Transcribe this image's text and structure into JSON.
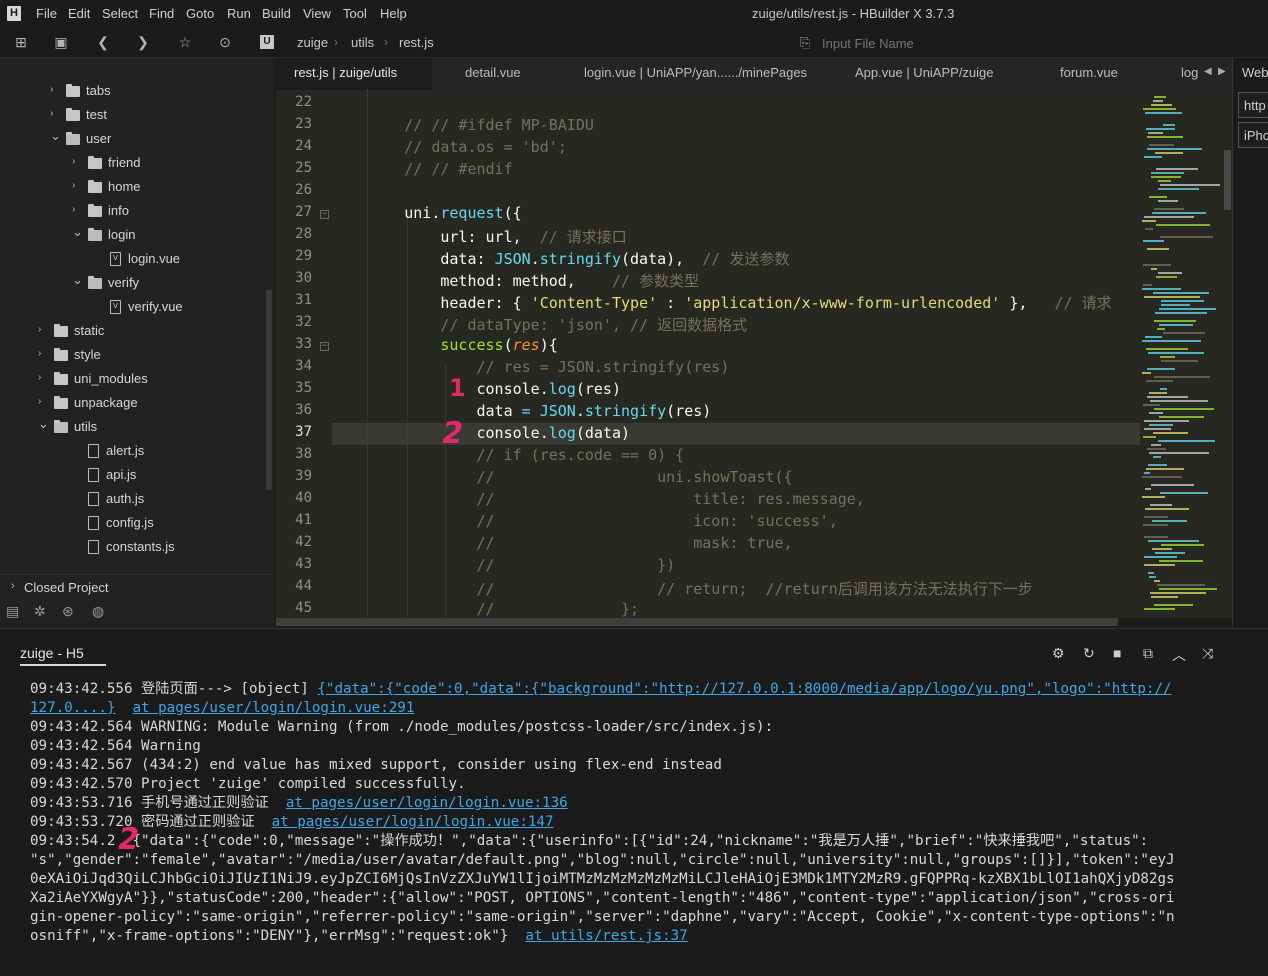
{
  "app": {
    "title": "zuige/utils/rest.js - HBuilder X 3.7.3",
    "menu": [
      "File",
      "Edit",
      "Select",
      "Find",
      "Goto",
      "Run",
      "Build",
      "View",
      "Tool",
      "Help"
    ]
  },
  "toolbar": {
    "breadcrumb": [
      "zuige",
      "utils",
      "rest.js"
    ],
    "file_search_placeholder": "Input File Name"
  },
  "sidebar": {
    "tree": [
      {
        "label": "tabs",
        "type": "folder",
        "expanded": false
      },
      {
        "label": "test",
        "type": "folder",
        "expanded": false
      },
      {
        "label": "user",
        "type": "folder",
        "expanded": true
      },
      {
        "label": "friend",
        "type": "folder",
        "expanded": false
      },
      {
        "label": "home",
        "type": "folder",
        "expanded": false
      },
      {
        "label": "info",
        "type": "folder",
        "expanded": false
      },
      {
        "label": "login",
        "type": "folder",
        "expanded": true
      },
      {
        "label": "login.vue",
        "type": "vue"
      },
      {
        "label": "verify",
        "type": "folder",
        "expanded": true
      },
      {
        "label": "verify.vue",
        "type": "vue"
      },
      {
        "label": "static",
        "type": "folder",
        "expanded": false
      },
      {
        "label": "style",
        "type": "folder",
        "expanded": false
      },
      {
        "label": "uni_modules",
        "type": "folder",
        "expanded": false
      },
      {
        "label": "unpackage",
        "type": "folder",
        "expanded": false
      },
      {
        "label": "utils",
        "type": "folder",
        "expanded": true
      },
      {
        "label": "alert.js",
        "type": "js"
      },
      {
        "label": "api.js",
        "type": "js"
      },
      {
        "label": "auth.js",
        "type": "js"
      },
      {
        "label": "config.js",
        "type": "js"
      },
      {
        "label": "constants.js",
        "type": "js"
      }
    ],
    "closed_project_label": "Closed Project"
  },
  "tabs": [
    {
      "label": "rest.js | zuige/utils",
      "active": true
    },
    {
      "label": "detail.vue",
      "active": false
    },
    {
      "label": "login.vue | UniAPP/yan....../minePages",
      "active": false
    },
    {
      "label": "App.vue | UniAPP/zuige",
      "active": false
    },
    {
      "label": "forum.vue",
      "active": false
    },
    {
      "label": "log",
      "active": false
    }
  ],
  "editor": {
    "line_numbers": [
      "22",
      "23",
      "24",
      "25",
      "26",
      "27",
      "28",
      "29",
      "30",
      "31",
      "32",
      "33",
      "34",
      "35",
      "36",
      "37",
      "38",
      "39",
      "40",
      "41",
      "42",
      "43",
      "44",
      "45"
    ],
    "highlighted_line": "37"
  },
  "right_panel": {
    "label": "Web",
    "url_field": "http",
    "device_field": "iPho"
  },
  "console": {
    "tab_label": "zuige - H5",
    "lines": [
      {
        "t": "09:43:42.556 登陆页面---> [object] ",
        "link": "{\"data\":{\"code\":0,\"data\":{\"background\":\"http://127.0.0.1:8000/media/app/logo/yu.png\",\"logo\":\"http://"
      },
      {
        "t": "",
        "link": "127.0....}",
        "link2": "at pages/user/login/login.vue:291"
      },
      {
        "t": "09:43:42.564 WARNING: Module Warning (from ./node_modules/postcss-loader/src/index.js):"
      },
      {
        "t": "09:43:42.564 Warning"
      },
      {
        "t": "09:43:42.567 (434:2) end value has mixed support, consider using flex-end instead"
      },
      {
        "t": "09:43:42.570 Project 'zuige' compiled successfully."
      },
      {
        "t": "09:43:53.716 手机号通过正则验证  ",
        "link": "at pages/user/login/login.vue:136"
      },
      {
        "t": "09:43:53.720 密码通过正则验证  ",
        "link": "at pages/user/login/login.vue:147"
      },
      {
        "t": "09:43:54.2  {\"data\":{\"code\":0,\"message\":\"操作成功！\",\"data\":{\"userinfo\":[{\"id\":24,\"nickname\":\"我是万人捶\",\"brief\":\"快来捶我吧\",\"status\":"
      },
      {
        "t": "\"s\",\"gender\":\"female\",\"avatar\":\"/media/user/avatar/default.png\",\"blog\":null,\"circle\":null,\"university\":null,\"groups\":[]}],\"token\":\"eyJ"
      },
      {
        "t": "0eXAiOiJqd3QiLCJhbGciOiJIUzI1NiJ9.eyJpZCI6MjQsInVzZXJuYW1lIjoiMTMzMzMzMzMzMzMiLCJleHAiOjE3MDk1MTY2MzR9.gFQPPRq-kzXBX1bLlOI1ahQXjyD82gs"
      },
      {
        "t": "Xa2iAeYXWgyA\"}},\"statusCode\":200,\"header\":{\"allow\":\"POST, OPTIONS\",\"content-length\":\"486\",\"content-type\":\"application/json\",\"cross-ori"
      },
      {
        "t": "gin-opener-policy\":\"same-origin\",\"referrer-policy\":\"same-origin\",\"server\":\"daphne\",\"vary\":\"Accept, Cookie\",\"x-content-type-options\":\"n"
      },
      {
        "t": "osniff\",\"x-frame-options\":\"DENY\"},\"errMsg\":\"request:ok\"}  ",
        "link": "at utils/rest.js:37"
      }
    ]
  },
  "annotations": {
    "mark1": "1",
    "mark2": "2",
    "mark3": "2"
  }
}
